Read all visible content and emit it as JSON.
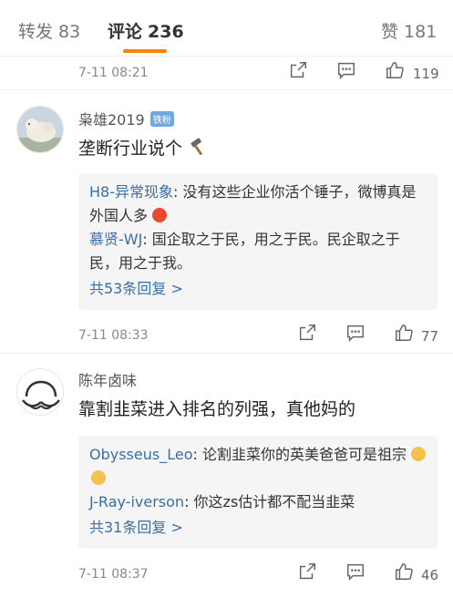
{
  "tabs": {
    "repost": {
      "label": "转发",
      "count": "83"
    },
    "comment": {
      "label": "评论",
      "count": "236"
    },
    "like": {
      "label": "赞",
      "count": "181"
    }
  },
  "top_bar": {
    "time": "7-11 08:21",
    "likes": "119"
  },
  "comments": [
    {
      "username": "枭雄2019",
      "badge": "铁粉",
      "text": "垄断行业说个",
      "time": "7-11 08:33",
      "likes": "77",
      "replies": [
        {
          "name": "H8-异常现象",
          "text": ": 没有这些企业你活个锤子，微博真是外国人多"
        },
        {
          "name": "慕贤-WJ",
          "text": ": 国企取之于民，用之于民。民企取之于民，用之于我。"
        }
      ],
      "more": "共53条回复 >"
    },
    {
      "username": "陈年卤味",
      "text": "靠割韭菜进入排名的列强，真他妈的",
      "time": "7-11 08:37",
      "likes": "46",
      "replies": [
        {
          "name": "Obysseus_Leo",
          "text": ": 论割韭菜你的英美爸爸可是祖宗"
        },
        {
          "name": "J-Ray-iverson",
          "text": ": 你这zs估计都不配当韭菜"
        }
      ],
      "more": "共31条回复 >"
    }
  ],
  "colors": {
    "accent": "#ff8200",
    "link": "#3b6ea5"
  }
}
